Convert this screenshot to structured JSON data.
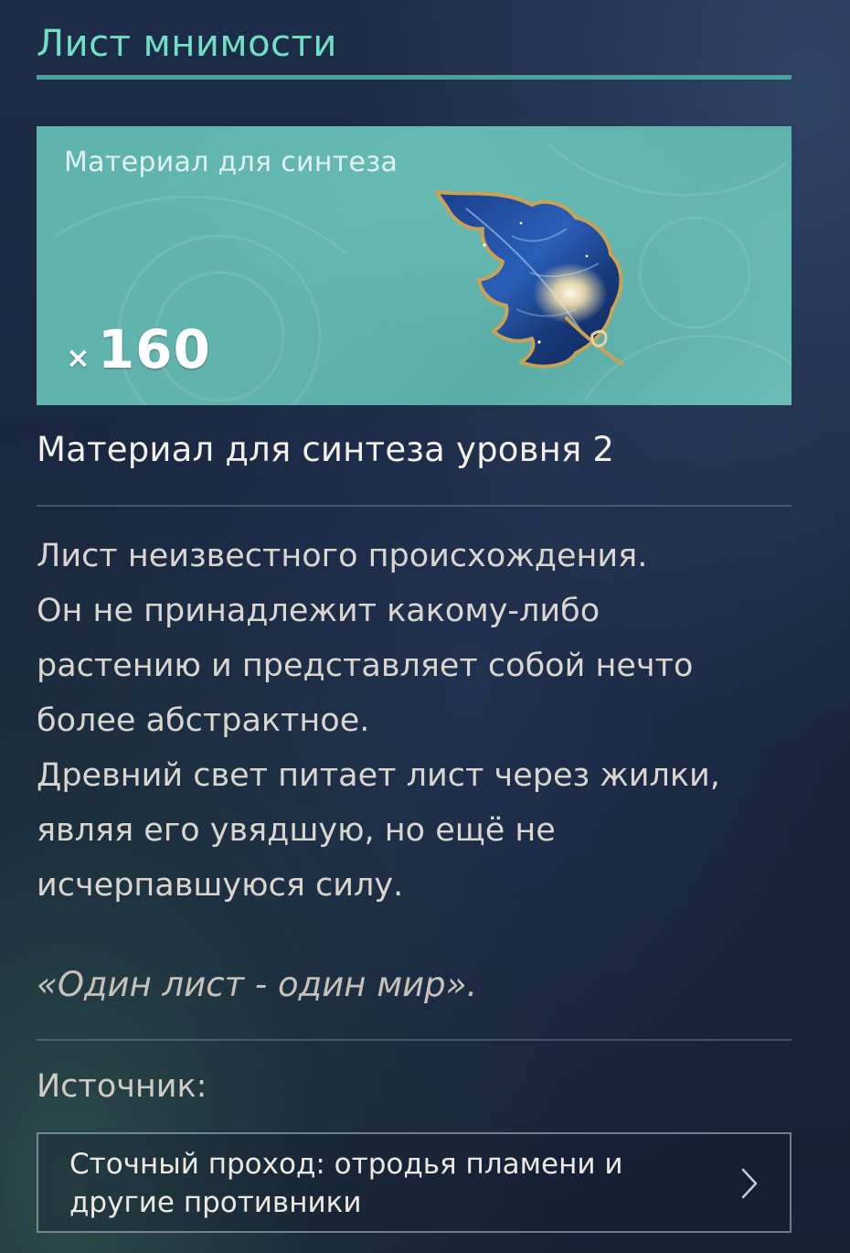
{
  "item": {
    "title": "Лист мнимости",
    "card_label": "Материал для синтеза",
    "count_prefix": "×",
    "count": "160",
    "subtitle": "Материал для синтеза уровня 2",
    "description_lines": [
      "Лист неизвестного происхождения.",
      "Он не принадлежит какому-либо",
      "растению и представляет собой нечто",
      "более абстрактное.",
      "Древний свет питает лист через жилки,",
      "являя его увядшую, но ещё не",
      "исчерпавшуюся силу."
    ],
    "quote": "«Один лист - один мир».",
    "icon": "mystic-leaf-icon"
  },
  "source": {
    "label": "Источник:",
    "button_lines": [
      "Сточный проход: отродья пламени и",
      "другие противники"
    ],
    "button_icon": "chevron-right-icon"
  },
  "colors": {
    "title_accent": "#6fe0c6",
    "underline": "#4aa39a",
    "card_background": "#5fb3ad",
    "page_background": "#1a2741"
  }
}
